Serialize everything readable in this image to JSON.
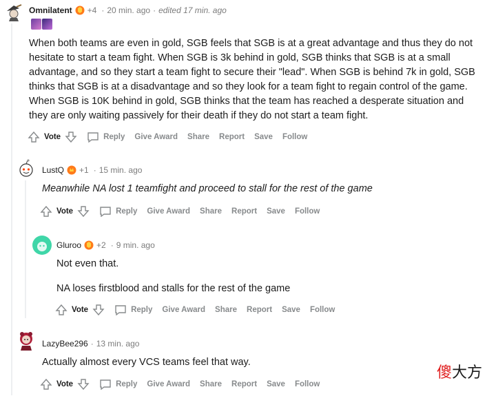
{
  "comments": [
    {
      "user": "Omnilatent",
      "karma": "+4",
      "time": "20 min. ago",
      "edited": "edited 17 min. ago",
      "paragraphs": [
        "When both teams are even in gold, SGB feels that SGB is at a great advantage and thus they do not hesitate to start a team fight. When SGB is 3k behind in gold, SGB thinks that SGB is at a small advantage, and so they start a team fight to secure their \"lead\". When SGB is behind 7k in gold, SGB thinks that SGB is at a disadvantage and so they look for a team fight to regain control of the game. When SGB is 10K behind in gold, SGB thinks that the team has reached a desperate situation and they are only waiting passively for their death if they do not start a team fight."
      ]
    },
    {
      "user": "LustQ",
      "karma": "+1",
      "time": "15 min. ago",
      "paragraphs": [
        "Meanwhile NA lost 1 teamfight and proceed to stall for the rest of the game"
      ]
    },
    {
      "user": "Gluroo",
      "karma": "+2",
      "time": "9 min. ago",
      "paragraphs": [
        "Not even that.",
        "NA loses firstblood and stalls for the rest of the game"
      ]
    },
    {
      "user": "LazyBee296",
      "time": "13 min. ago",
      "paragraphs": [
        "Actually almost every VCS teams feel that way."
      ]
    }
  ],
  "actions": {
    "vote": "Vote",
    "reply": "Reply",
    "give_award": "Give Award",
    "share": "Share",
    "report": "Report",
    "save": "Save",
    "follow": "Follow"
  },
  "watermark": {
    "red": "傻",
    "black": "大方"
  },
  "colors": {
    "thread_line": "#edeff1",
    "action_gray": "#878a8c",
    "badge_orange": "#ff7a1a",
    "gluroo_avatar": "#3fd6a8"
  }
}
